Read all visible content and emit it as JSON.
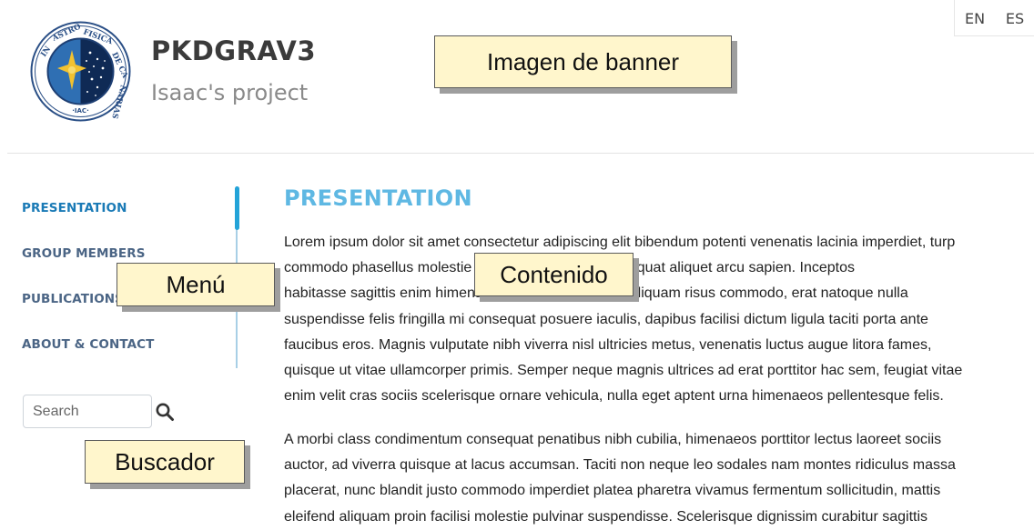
{
  "header": {
    "logo": {
      "lettering": "INSTITUTO DE ASTROFISICA DE CANARIAS · IAC",
      "colors": [
        "#1f4f8f",
        "#0f2a55",
        "#f2c230"
      ]
    },
    "title": "PKDGRAV3",
    "subtitle": "Isaac's project",
    "languages": [
      "EN",
      "ES"
    ]
  },
  "annotations": {
    "banner": "Imagen de banner",
    "menu": "Menú",
    "content": "Contenido",
    "search": "Buscador"
  },
  "nav": {
    "items": [
      {
        "label": "PRESENTATION",
        "active": true
      },
      {
        "label": "GROUP MEMBERS"
      },
      {
        "label": "PUBLICATIONS"
      },
      {
        "label": "ABOUT & CONTACT"
      }
    ],
    "accent": "#23a3d8"
  },
  "search": {
    "placeholder": "Search",
    "icon": "search-icon"
  },
  "content": {
    "title": "PRESENTATION",
    "paragraph1": [
      "Lorem ipsum dolor sit amet consectetur adipiscing elit bibendum potenti venenatis lacinia imperdiet, turp",
      "commodo phasellus molestie himenaeos cursus consequat aliquet arcu sapien. Inceptos",
      "habitasse sagittis enim himenaeos nibh laoreet fusce aliquam risus commodo, erat natoque nulla",
      "suspendisse felis fringilla mi consequat posuere iaculis, dapibus facilisi dictum ligula taciti porta ante",
      "faucibus eros. Magnis vulputate nibh viverra nisl ultricies metus, venenatis luctus augue litora fames,",
      "quisque ut vitae ullamcorper primis. Semper neque magnis ultrices ad erat porttitor hac sem, feugiat vitae",
      "enim velit cras sociis scelerisque ornare vehicula, nulla eget aptent urna himenaeos pellentesque felis."
    ],
    "paragraph2": [
      "A morbi class condimentum consequat penatibus nibh cubilia, himenaeos porttitor lectus laoreet sociis",
      "auctor, ad viverra quisque at lacus accumsan. Taciti non neque leo sodales nam montes ridiculus massa",
      "placerat, nunc blandit justo commodo imperdiet platea pharetra vivamus fermentum sollicitudin, mattis",
      "eleifend aliquam proin facilisi molestie pulvinar suspendisse. Scelerisque dignissim curabitur sagittis"
    ]
  }
}
